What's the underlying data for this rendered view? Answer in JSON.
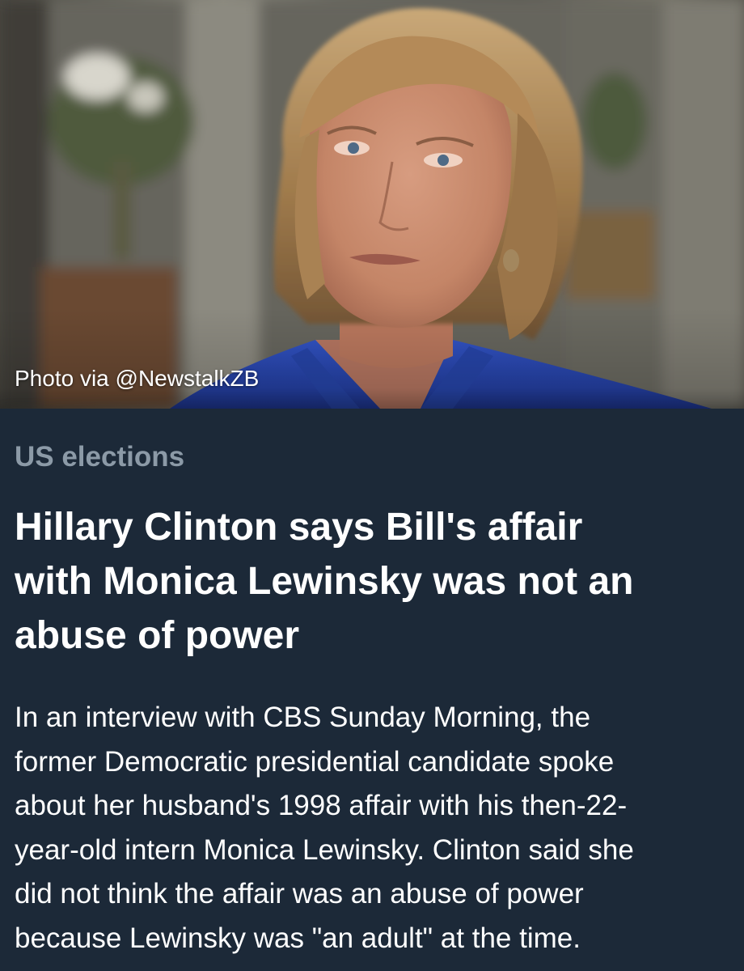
{
  "photo": {
    "credit": "Photo via @NewstalkZB",
    "colors": {
      "background": "#6d6c63",
      "hair": "#a07b4c",
      "skin": "#c98e72",
      "jacket": "#2b49b5"
    }
  },
  "article": {
    "category": "US elections",
    "headline_lines": [
      "Hillary Clinton says Bill's affair",
      "with Monica Lewinsky was not an",
      "abuse of power"
    ],
    "summary_lines": [
      "In an interview with CBS Sunday Morning, the",
      "former Democratic presidential candidate spoke",
      "about her husband's 1998 affair with his then-22-",
      "year-old intern Monica Lewinsky. Clinton said she",
      "did not think the affair was an abuse of power",
      "because Lewinsky was \"an adult\" at the time."
    ]
  },
  "colors": {
    "card_background": "#1c2938",
    "category_text": "#8c9aa7",
    "headline_text": "#ffffff",
    "summary_text": "#ffffff"
  }
}
